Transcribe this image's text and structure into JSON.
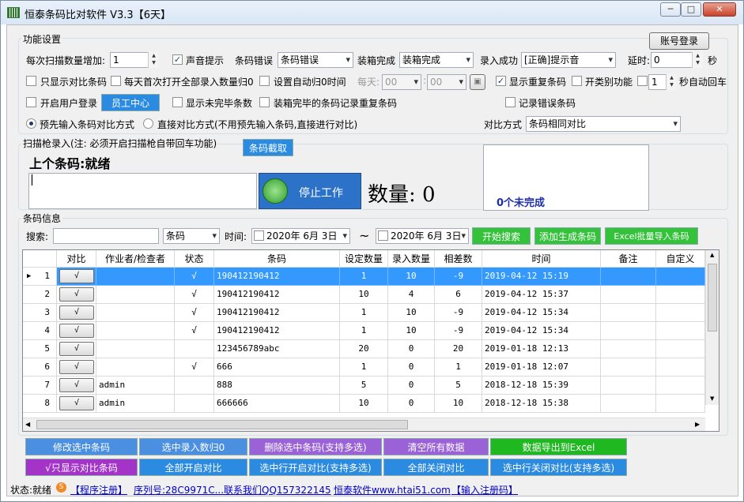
{
  "window": {
    "title": "恒泰条码比对软件 V3.3【6天】",
    "btn_min": "─",
    "btn_max": "□",
    "btn_close": "✕"
  },
  "settings": {
    "group_label": "功能设置",
    "account_login": "账号登录",
    "scan_increment_label": "每次扫描数量增加:",
    "scan_increment_value": "1",
    "sound_prompt": "声音提示",
    "barcode_error_label": "条码错误",
    "barcode_error_value": "条码错误",
    "box_complete_label": "装箱完成",
    "box_complete_value": "装箱完成",
    "entry_success_label": "录入成功",
    "entry_success_value": "[正确]提示音",
    "delay_label": "延时:",
    "delay_value": "0",
    "delay_unit": "秒",
    "only_compare": "只显示对比条码",
    "daily_reset": "每天首次打开全部录入数量归0",
    "auto_reset_time": "设置自动归0时间",
    "daily_label": "每天:",
    "time_h": "00",
    "time_m": "00",
    "show_duplicates": "显示重复条码",
    "category_func": "开类别功能",
    "auto_enter_value": "1",
    "auto_enter_suffix": "秒自动回车",
    "user_login": "开启用户登录",
    "staff_center": "员工中心",
    "show_unfinished": "显示未完毕条数",
    "box_dup": "装箱完毕的条码记录重复条码",
    "record_errors": "记录错误条码",
    "mode_preinput": "预先输入条码对比方式",
    "mode_direct": "直接对比方式(不用预先输入条码,直接进行对比)",
    "compare_method_label": "对比方式",
    "compare_method_value": "条码相同对比"
  },
  "scan": {
    "group_label": "扫描枪录入(注: 必须开启扫描枪自带回车功能)",
    "capture_btn": "条码截取",
    "last_label": "上个条码:就绪",
    "stop_btn": "停止工作",
    "count_label": "数量: 0",
    "unfinished": "0个未完成"
  },
  "info": {
    "group_label": "条码信息",
    "search_label": "搜索:",
    "search_type": "条码",
    "time_label": "时间:",
    "date_from": "2020年 6月 3日",
    "tilde": "~",
    "date_to": "2020年 6月 3日",
    "start_search": "开始搜索",
    "add_barcode": "添加生成条码",
    "excel_import": "Excel批量导入条码"
  },
  "table": {
    "columns": [
      "对比",
      "作业者/检查者",
      "状态",
      "条码",
      "设定数量",
      "录入数量",
      "相差数",
      "时间",
      "备注",
      "自定义"
    ],
    "rows": [
      {
        "no": "1",
        "operator": "",
        "status": "√",
        "barcode": "190412190412",
        "set": "1",
        "input": "10",
        "diff": "-9",
        "time": "2019-04-12 15:19",
        "selected": true
      },
      {
        "no": "2",
        "operator": "",
        "status": "√",
        "barcode": "190412190412",
        "set": "10",
        "input": "4",
        "diff": "6",
        "time": "2019-04-12 15:37",
        "selected": false
      },
      {
        "no": "3",
        "operator": "",
        "status": "√",
        "barcode": "190412190412",
        "set": "1",
        "input": "10",
        "diff": "-9",
        "time": "2019-04-12 15:34",
        "selected": false
      },
      {
        "no": "4",
        "operator": "",
        "status": "√",
        "barcode": "190412190412",
        "set": "1",
        "input": "10",
        "diff": "-9",
        "time": "2019-04-12 15:34",
        "selected": false
      },
      {
        "no": "5",
        "operator": "",
        "status": "",
        "barcode": "123456789abc",
        "set": "20",
        "input": "0",
        "diff": "20",
        "time": "2019-01-18 12:13",
        "selected": false
      },
      {
        "no": "6",
        "operator": "",
        "status": "√",
        "barcode": "666",
        "set": "1",
        "input": "0",
        "diff": "1",
        "time": "2019-01-18 12:07",
        "selected": false
      },
      {
        "no": "7",
        "operator": "admin",
        "status": "",
        "barcode": "888",
        "set": "5",
        "input": "0",
        "diff": "5",
        "time": "2018-12-18 15:39",
        "selected": false
      },
      {
        "no": "8",
        "operator": "admin",
        "status": "",
        "barcode": "666666",
        "set": "10",
        "input": "0",
        "diff": "10",
        "time": "2018-12-18 15:38",
        "selected": false
      }
    ],
    "check_label": "√"
  },
  "actions": {
    "edit_selected": "修改选中条码",
    "reset_selected": "选中录入数归0",
    "delete_selected": "删除选中条码(支持多选)",
    "clear_all": "清空所有数据",
    "export_excel": "数据导出到Excel",
    "only_show_compare": "√只显示对比条码",
    "enable_all": "全部开启对比",
    "enable_selected": "选中行开启对比(支持多选)",
    "disable_all": "全部关闭对比",
    "disable_selected": "选中行关闭对比(支持多选)"
  },
  "status": {
    "state": "状态:就绪",
    "register": "【程序注册】",
    "serial": "序列号:28C9971C...",
    "contact": "联系我们QQ157322145",
    "website": "恒泰软件www.htai51.com",
    "input_code": "【输入注册码】"
  },
  "colors": {
    "blue_btn": "#2b8be0",
    "purple_btn": "#9a62d6",
    "green_btn": "#33c23a",
    "select_row": "#3399ff"
  }
}
